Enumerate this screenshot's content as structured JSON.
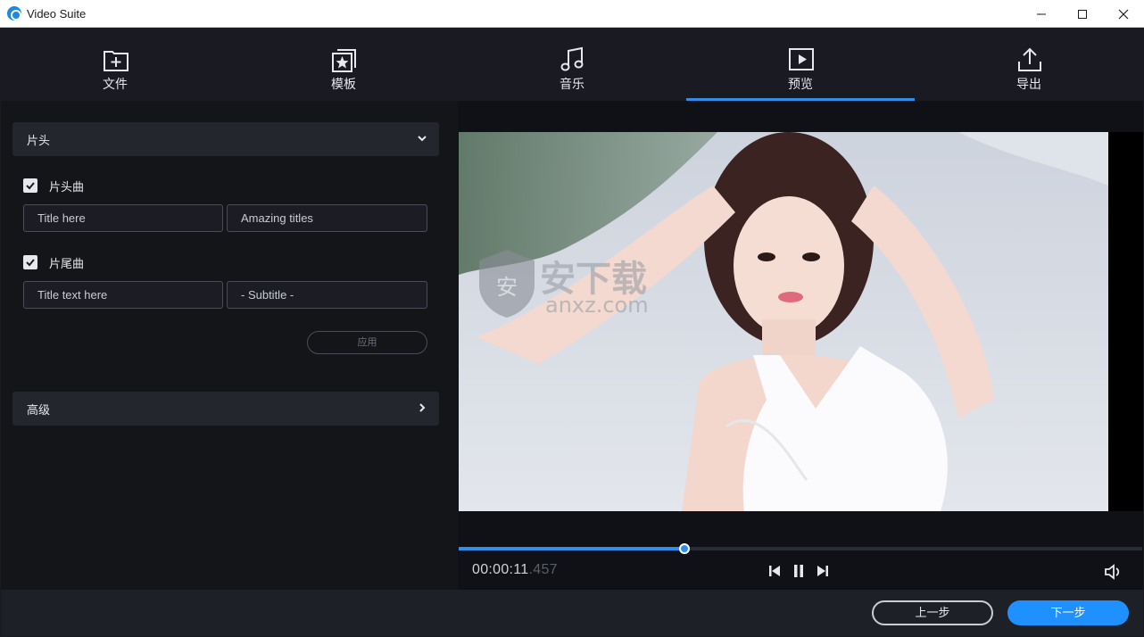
{
  "window": {
    "title": "Video Suite"
  },
  "nav": {
    "tabs": [
      {
        "label": "文件",
        "icon": "add-file-icon"
      },
      {
        "label": "模板",
        "icon": "template-star-icon"
      },
      {
        "label": "音乐",
        "icon": "music-note-icon"
      },
      {
        "label": "预览",
        "icon": "play-preview-icon",
        "active": true
      },
      {
        "label": "导出",
        "icon": "upload-export-icon"
      }
    ]
  },
  "left": {
    "intro_section": "片头",
    "opening_song": {
      "label": "片头曲",
      "checked": true,
      "title_value": "Title here",
      "subtitle_value": "Amazing titles"
    },
    "ending_song": {
      "label": "片尾曲",
      "checked": true,
      "title_value": "Title text here",
      "subtitle_value": "- Subtitle -"
    },
    "apply_label": "应用",
    "advanced_section": "高级"
  },
  "player": {
    "time_main": "00:00:11",
    "time_ms": ".457",
    "progress": 0.33,
    "watermark_text": "安下载",
    "watermark_sub": "anxz.com"
  },
  "footer": {
    "prev_label": "上一步",
    "next_label": "下一步"
  },
  "colors": {
    "accent": "#2f8ee8",
    "next_button": "#1e90ff",
    "background": "#1a1b22"
  }
}
